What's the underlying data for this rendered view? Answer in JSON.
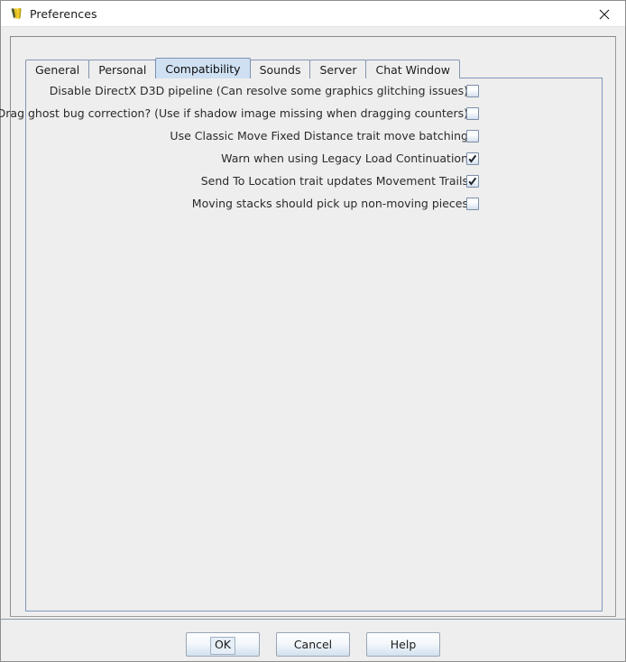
{
  "window": {
    "title": "Preferences",
    "icon": "vassal-logo-icon",
    "close_icon": "close-icon"
  },
  "tabs": [
    {
      "label": "General",
      "selected": false
    },
    {
      "label": "Personal",
      "selected": false
    },
    {
      "label": "Compatibility",
      "selected": true
    },
    {
      "label": "Sounds",
      "selected": false
    },
    {
      "label": "Server",
      "selected": false
    },
    {
      "label": "Chat Window",
      "selected": false
    }
  ],
  "preferences": [
    {
      "label": "Disable DirectX D3D pipeline (Can resolve some graphics glitching issues)",
      "checked": false
    },
    {
      "label": "Drag ghost bug correction? (Use if shadow image missing when dragging counters)",
      "checked": false
    },
    {
      "label": "Use Classic Move Fixed Distance trait move batching",
      "checked": false
    },
    {
      "label": "Warn when using Legacy Load Continuation",
      "checked": true
    },
    {
      "label": "Send To Location trait updates Movement Trails",
      "checked": true
    },
    {
      "label": "Moving stacks should pick up non-moving pieces",
      "checked": false
    }
  ],
  "buttons": [
    {
      "label": "OK",
      "focused": true
    },
    {
      "label": "Cancel",
      "focused": false
    },
    {
      "label": "Help",
      "focused": false
    }
  ],
  "colors": {
    "dialog_background": "#eeeeee",
    "titlebar_background": "#ffffff",
    "selected_tab": "#cfe0f2",
    "tab_border": "#8496b0",
    "panel_border": "#7f97bb",
    "text": "#2b2b2b"
  }
}
